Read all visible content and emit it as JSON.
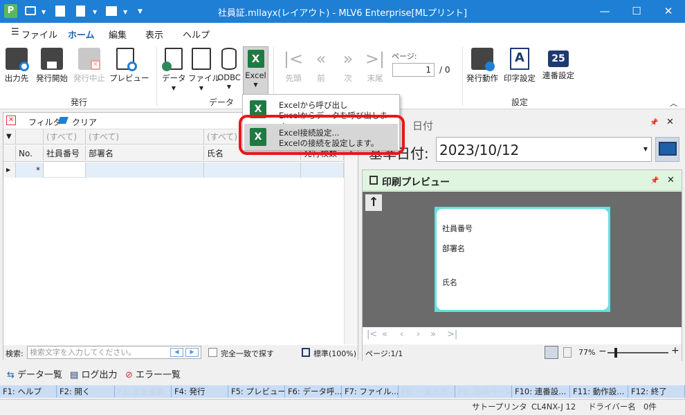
{
  "titlebar": {
    "title": "社員証.mllayx(レイアウト) - MLV6 Enterprise[MLプリント]",
    "app_icon": "P"
  },
  "menubar": {
    "file": "ファイル",
    "home": "ホーム",
    "edit": "編集",
    "view": "表示",
    "help": "ヘルプ"
  },
  "ribbon": {
    "issue": {
      "label": "発行",
      "output": "出力先",
      "start": "発行開始",
      "stop": "発行中止",
      "preview": "プレビュー"
    },
    "data": {
      "label": "データ",
      "data": "データ",
      "file": "ファイル",
      "odbc": "ODBC",
      "excel": "Excel"
    },
    "nav": {
      "first": "先頭",
      "prev": "前",
      "next": "次",
      "last": "末尾",
      "page_label": "ページ:",
      "page_value": "1",
      "page_total": "/ 0"
    },
    "settings": {
      "label": "設定",
      "action": "発行動作",
      "print": "印字設定",
      "serial": "連番設定"
    }
  },
  "dropdown": {
    "item1_title": "Excelから呼び出し",
    "item1_desc": "Excelからデータを呼び出します。",
    "item2_title": "Excel接続設定...",
    "item2_desc": "Excelの接続を設定します。"
  },
  "left_panel": {
    "filter": "フィルタ",
    "clear": "クリア",
    "filter_all": "(すべて)",
    "columns": [
      "No.",
      "社員番号",
      "部署名",
      "氏名",
      "発行枚数"
    ],
    "new_row_marker": "*",
    "search_label": "検索:",
    "search_placeholder": "検索文字を入力してください。",
    "exact_match": "完全一致で探す",
    "zoom": "標準(100%)"
  },
  "date_panel": {
    "header": "日付",
    "label": "基準日付:",
    "value": "2023/10/12"
  },
  "preview_panel": {
    "header": "印刷プレビュー",
    "card_fields": [
      "社員番号",
      "部署名",
      "氏名"
    ],
    "page_info": "ページ:1/1",
    "zoom": "77%"
  },
  "bottom_tabs": {
    "data_list": "データ一覧",
    "log": "ログ出力",
    "errors": "エラー一覧"
  },
  "fkeys": [
    "F1: ヘルプ",
    "F2: 開く",
    "F3: 次を検索",
    "F4: 発行",
    "F5: プレビュー",
    "F6: データ呼...",
    "F7: ファイル...",
    "F8: 一覧入力",
    "F9: 次のページ",
    "F10: 連番設...",
    "F11: 動作設...",
    "F12: 終了"
  ],
  "statusbar": {
    "printer": "サトープリンタ",
    "model": "CL4NX-J 12",
    "driver": "ドライバー名",
    "count": "0件"
  },
  "colors": {
    "titlebar": "#1e7fd4",
    "highlight": "#e8161a",
    "fkey_bg": "#c9ddf5",
    "preview_bg": "#6b6b6b",
    "card_border": "#66e0e0"
  }
}
